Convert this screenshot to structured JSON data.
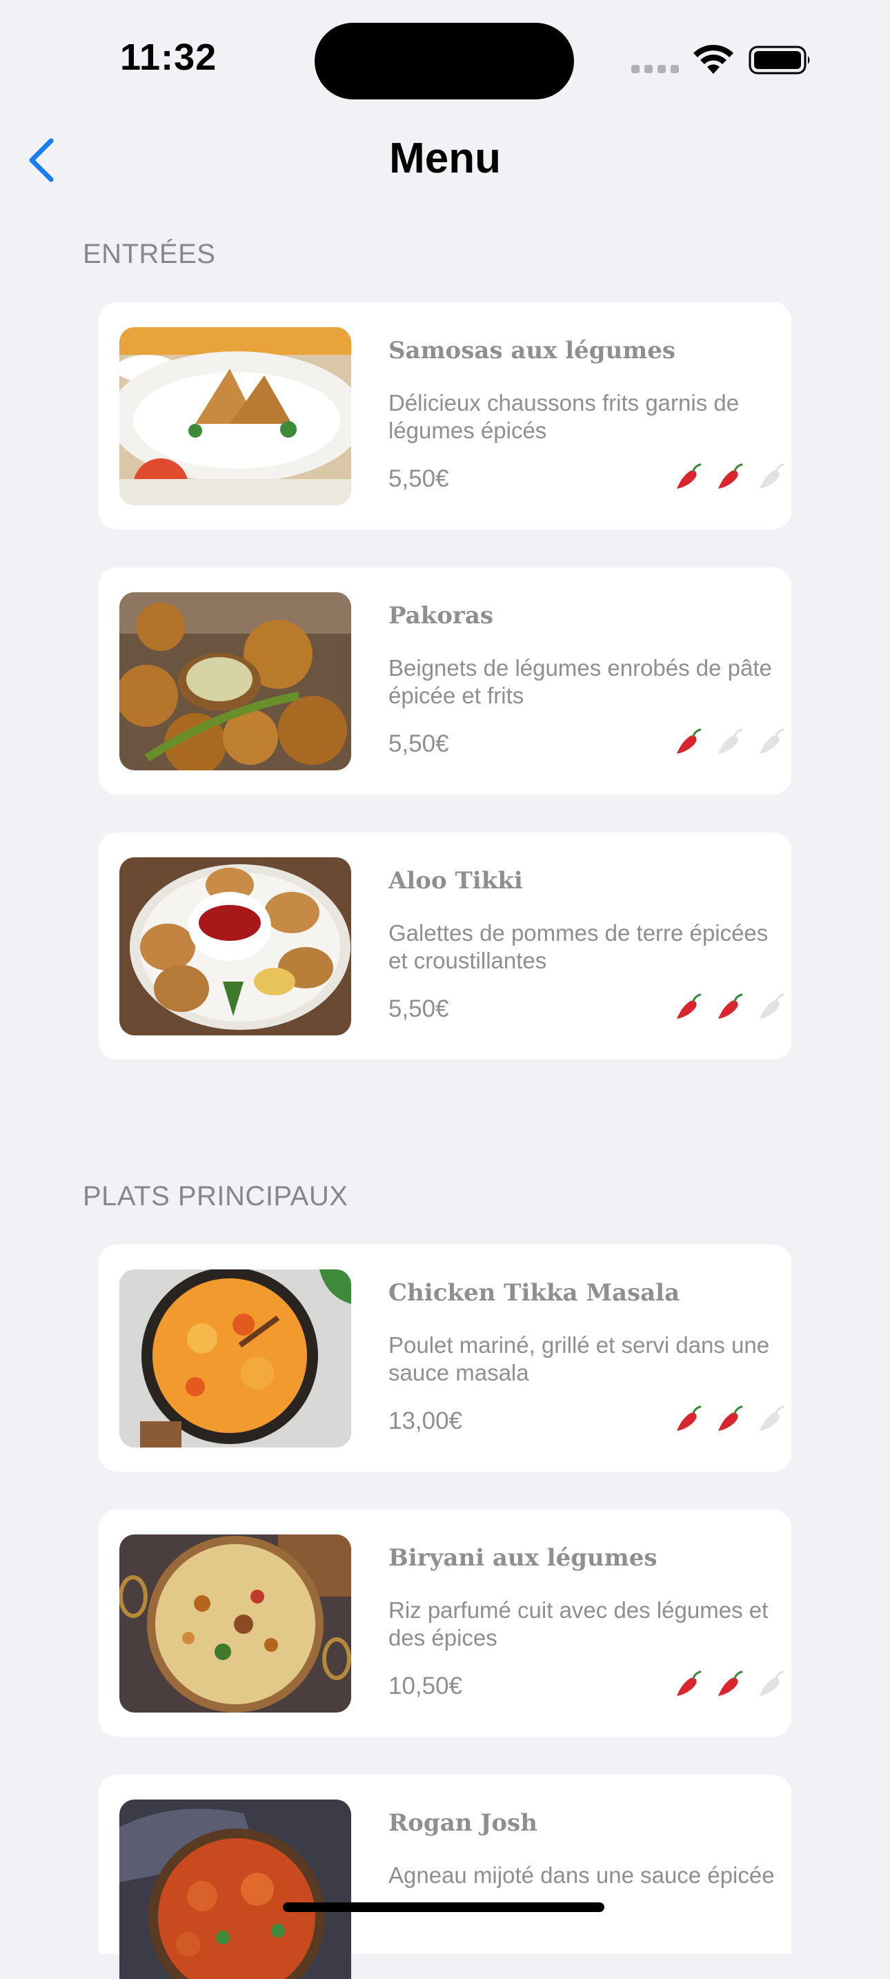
{
  "status_bar": {
    "time": "11:32"
  },
  "nav": {
    "title": "Menu",
    "back_icon": "chevron-left-icon"
  },
  "colors": {
    "accent": "#1A7CF5",
    "spice_on": "#D9262E",
    "spice_off": "#E2E2E6",
    "background": "#F1F1F6"
  },
  "sections": [
    {
      "title": "ENTRÉES",
      "items": [
        {
          "name": "Samosas aux légumes",
          "description": "Délicieux chaussons frits garnis de légumes épicés",
          "price": "5,50€",
          "spice_level": 2,
          "spice_max": 3
        },
        {
          "name": "Pakoras",
          "description": "Beignets de légumes enrobés de pâte épicée et frits",
          "price": "5,50€",
          "spice_level": 1,
          "spice_max": 3
        },
        {
          "name": "Aloo Tikki",
          "description": "Galettes de pommes de terre épicées et croustillantes",
          "price": "5,50€",
          "spice_level": 2,
          "spice_max": 3
        }
      ]
    },
    {
      "title": "PLATS PRINCIPAUX",
      "items": [
        {
          "name": "Chicken Tikka Masala",
          "description": "Poulet mariné, grillé et servi dans une sauce masala",
          "price": "13,00€",
          "spice_level": 2,
          "spice_max": 3
        },
        {
          "name": "Biryani aux légumes",
          "description": "Riz parfumé cuit avec des légumes et des épices",
          "price": "10,50€",
          "spice_level": 2,
          "spice_max": 3
        },
        {
          "name": "Rogan Josh",
          "description": "Agneau mijoté dans une sauce épicée",
          "price": "",
          "spice_level": 0,
          "spice_max": 3
        }
      ]
    }
  ]
}
